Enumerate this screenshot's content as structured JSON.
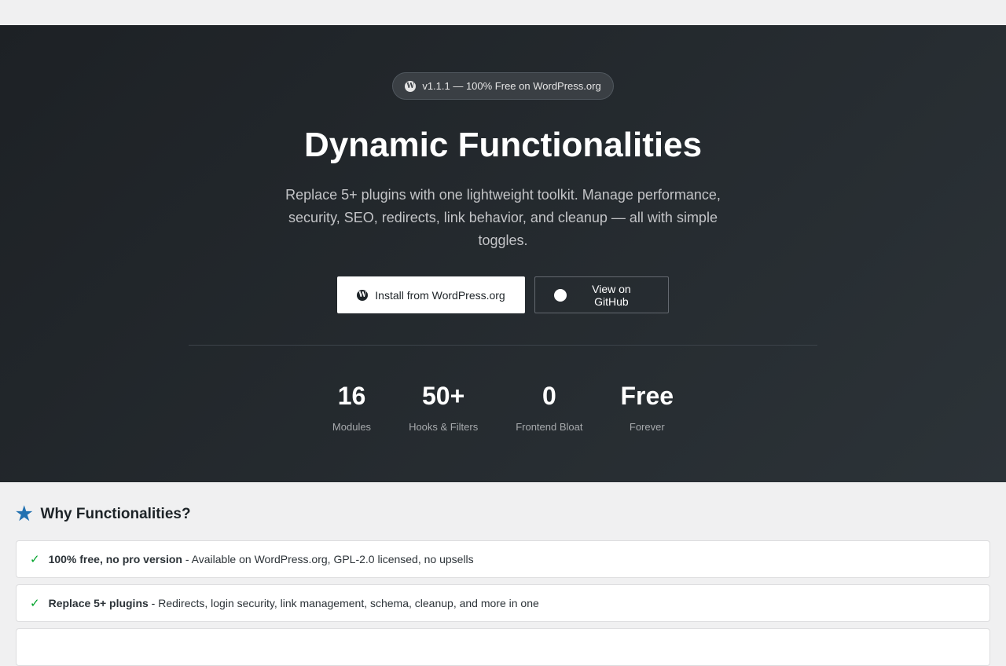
{
  "hero": {
    "badge": "v1.1.1 — 100% Free on WordPress.org",
    "title": "Dynamic Functionalities",
    "subtitle": "Replace 5+ plugins with one lightweight toolkit. Manage performance, security, SEO, redirects, link behavior, and cleanup — all with simple toggles.",
    "install_label": "Install from WordPress.org",
    "github_label": "View on GitHub",
    "stats": [
      {
        "value": "16",
        "label": "Modules"
      },
      {
        "value": "50+",
        "label": "Hooks & Filters"
      },
      {
        "value": "0",
        "label": "Frontend Bloat"
      },
      {
        "value": "Free",
        "label": "Forever"
      }
    ]
  },
  "why": {
    "title": "Why Functionalities?",
    "items": [
      {
        "bold": "100% free, no pro version",
        "text": " - Available on WordPress.org, GPL-2.0 licensed, no upsells"
      },
      {
        "bold": "Replace 5+ plugins",
        "text": " - Redirects, login security, link management, schema, cleanup, and more in one"
      },
      {
        "bold": "",
        "text": ""
      }
    ]
  }
}
